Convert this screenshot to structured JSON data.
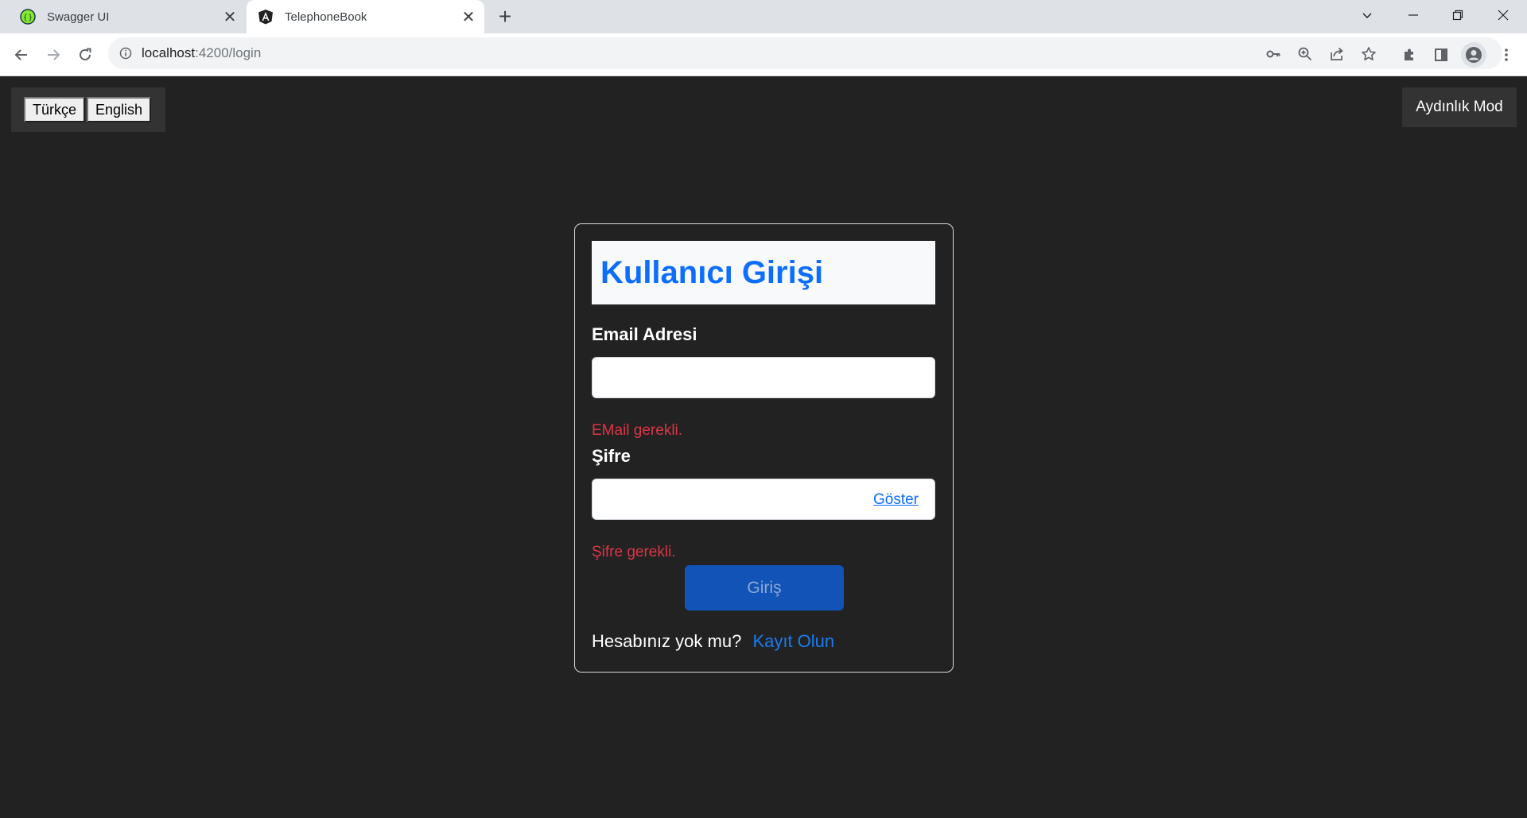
{
  "browser": {
    "tabs": [
      {
        "title": "Swagger UI",
        "icon": "swagger-icon",
        "active": false
      },
      {
        "title": "TelephoneBook",
        "icon": "angular-icon",
        "active": true
      }
    ],
    "address": {
      "host": "localhost",
      "path": ":4200/login"
    }
  },
  "page": {
    "language_buttons": {
      "turkish": "Türkçe",
      "english": "English"
    },
    "theme_toggle": "Aydınlık Mod",
    "login": {
      "title": "Kullanıcı Girişi",
      "email_label": "Email Adresi",
      "email_value": "",
      "email_error": "EMail gerekli.",
      "password_label": "Şifre",
      "password_value": "",
      "show_password": "Göster",
      "password_error": "Şifre gerekli.",
      "submit": "Giriş",
      "no_account": "Hesabınız yok mu?",
      "register": "Kayıt Olun"
    }
  },
  "colors": {
    "background": "#222222",
    "primary": "#0d6efd",
    "error": "#dc3545",
    "button": "#1153b6"
  }
}
